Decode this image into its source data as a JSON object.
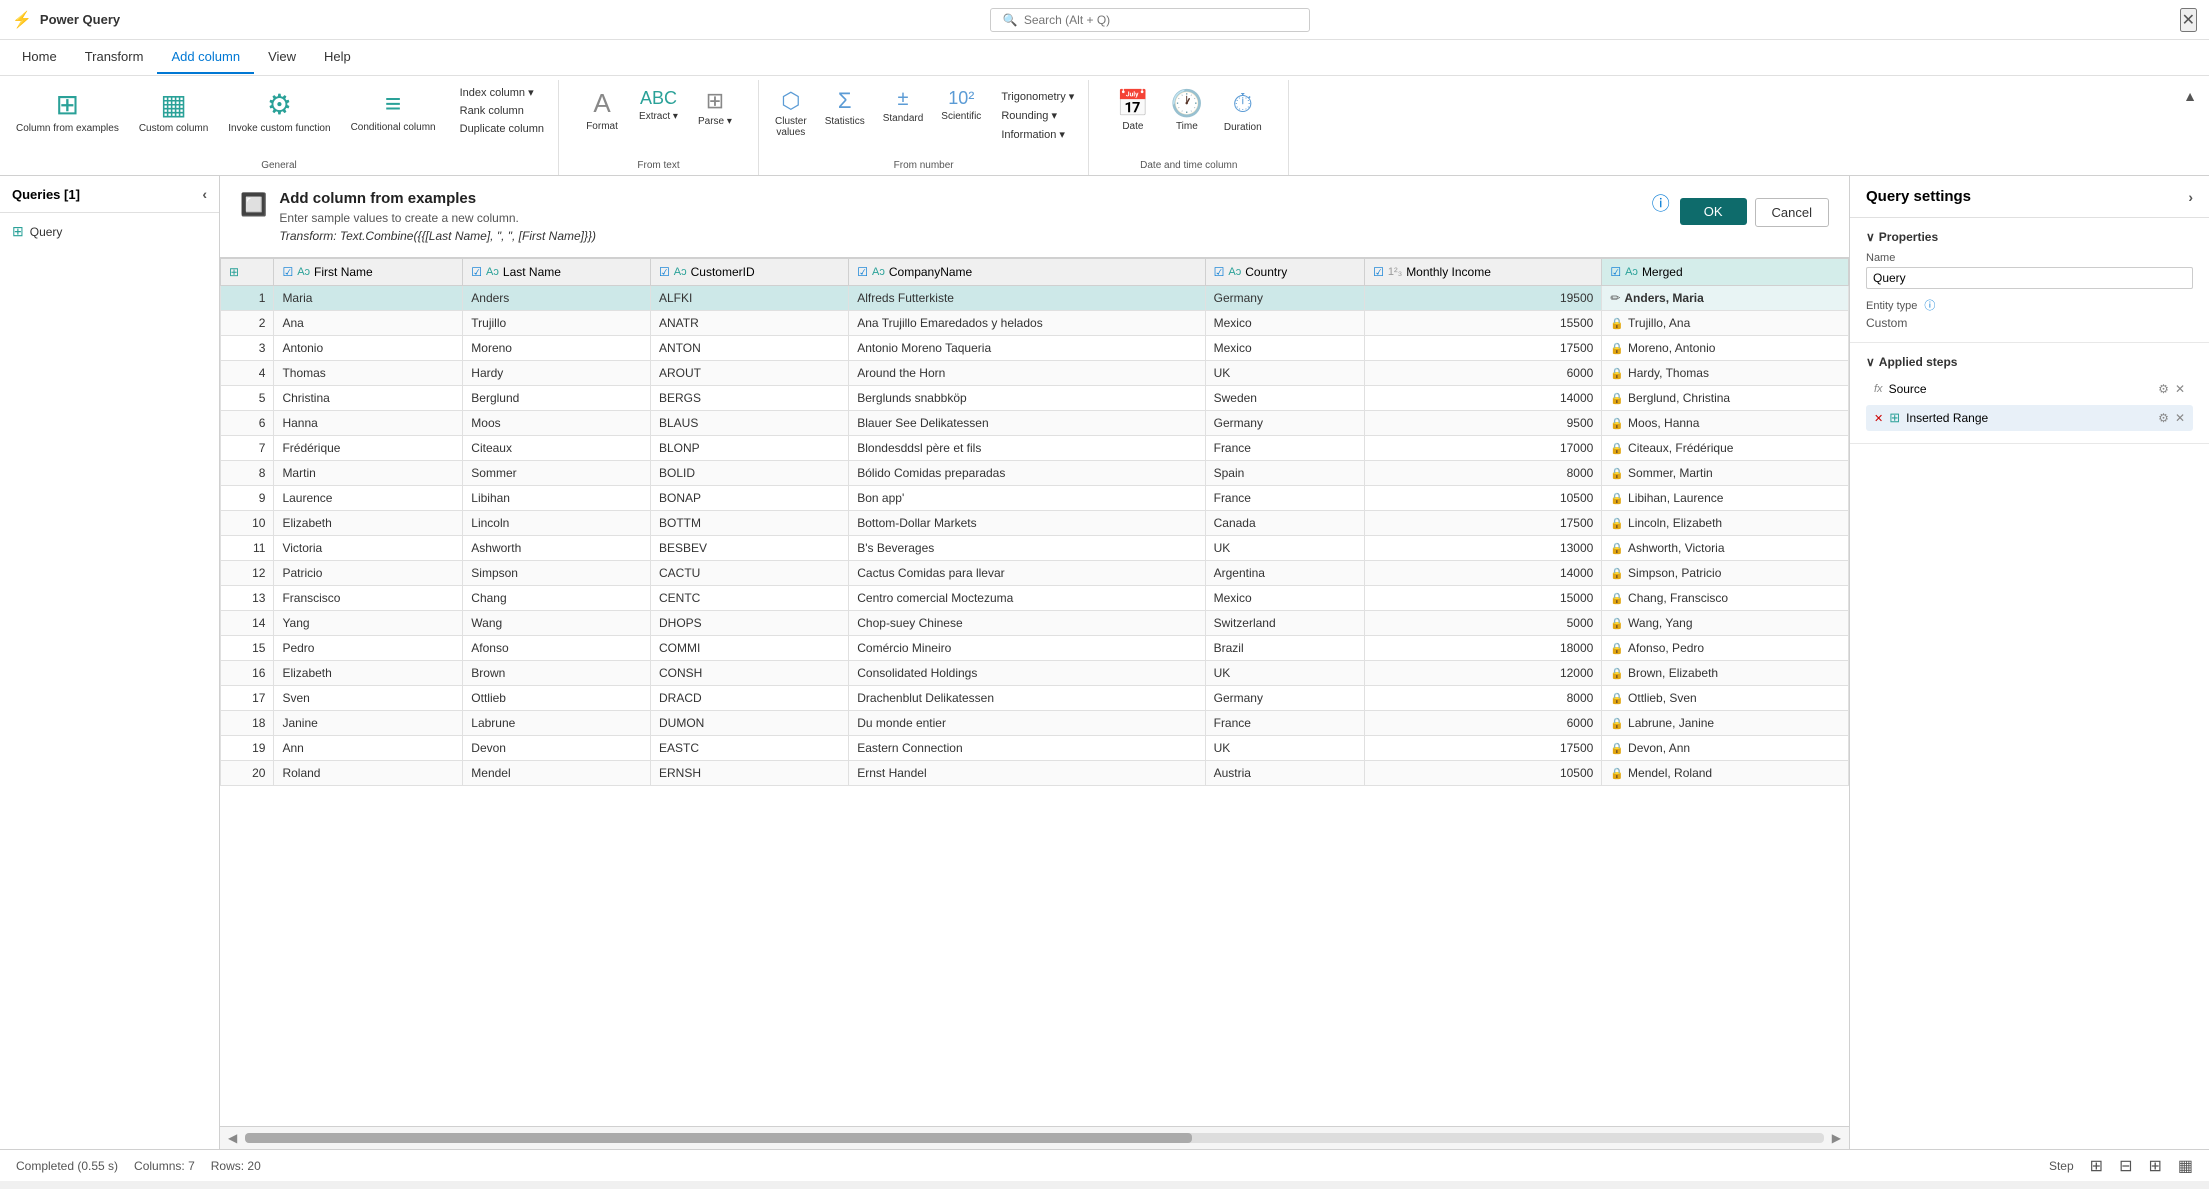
{
  "titleBar": {
    "appName": "Power Query",
    "search": {
      "placeholder": "Search (Alt + Q)"
    },
    "close": "✕"
  },
  "menuBar": {
    "items": [
      {
        "label": "Home",
        "active": false
      },
      {
        "label": "Transform",
        "active": false
      },
      {
        "label": "Add column",
        "active": true
      },
      {
        "label": "View",
        "active": false
      },
      {
        "label": "Help",
        "active": false
      }
    ]
  },
  "ribbon": {
    "groups": [
      {
        "label": "General",
        "buttons": [
          {
            "id": "col-from-examples",
            "icon": "⊞",
            "label": "Column from\nexamples"
          },
          {
            "id": "custom-column",
            "icon": "▦",
            "label": "Custom\ncolumn"
          },
          {
            "id": "invoke-custom",
            "icon": "⚙",
            "label": "Invoke custom\nfunction"
          },
          {
            "id": "conditional-col",
            "icon": "≡",
            "label": "Conditional\ncolumn"
          }
        ],
        "smallButtons": [
          {
            "id": "index-column",
            "label": "Index column ▾"
          },
          {
            "id": "rank-column",
            "label": "Rank column"
          },
          {
            "id": "duplicate-column",
            "label": "Duplicate column"
          }
        ]
      },
      {
        "label": "From text",
        "buttons": [
          {
            "id": "format",
            "icon": "A",
            "label": "Format"
          },
          {
            "id": "extract",
            "icon": "ABC",
            "label": "Extract ▾"
          },
          {
            "id": "parse",
            "icon": "⊞",
            "label": "Parse ▾"
          }
        ]
      },
      {
        "label": "From number",
        "buttons": [
          {
            "id": "cluster-values",
            "icon": "⬡",
            "label": "Cluster\nvalues"
          },
          {
            "id": "statistics",
            "icon": "Σ",
            "label": "Statistics"
          },
          {
            "id": "standard",
            "icon": "±",
            "label": "Standard"
          },
          {
            "id": "scientific",
            "icon": "10²",
            "label": "Scientific"
          },
          {
            "id": "trigonometry",
            "label": "Trigonometry ▾"
          },
          {
            "id": "rounding",
            "label": "Rounding ▾"
          },
          {
            "id": "information",
            "label": "Information ▾"
          }
        ]
      },
      {
        "label": "Date and time column",
        "buttons": [
          {
            "id": "date",
            "icon": "📅",
            "label": "Date"
          },
          {
            "id": "time",
            "icon": "🕐",
            "label": "Time"
          },
          {
            "id": "duration",
            "icon": "⏱",
            "label": "Duration"
          }
        ]
      }
    ],
    "collapseLabel": "▲"
  },
  "queriesPanel": {
    "header": "Queries [1]",
    "items": [
      {
        "label": "Query",
        "icon": "⊞"
      }
    ]
  },
  "examplesBanner": {
    "icon": "🔲",
    "title": "Add column from examples",
    "subtitle": "Enter sample values to create a new column.",
    "transform": "Transform: Text.Combine({{[Last Name], \", \", [First Name]}})",
    "okLabel": "OK",
    "cancelLabel": "Cancel",
    "helpIcon": "ⓘ"
  },
  "table": {
    "columns": [
      {
        "id": "row-num",
        "label": "#"
      },
      {
        "id": "first-name",
        "type": "text",
        "label": "First Name"
      },
      {
        "id": "last-name",
        "type": "text",
        "label": "Last Name"
      },
      {
        "id": "customer-id",
        "type": "text",
        "label": "CustomerID"
      },
      {
        "id": "company-name",
        "type": "text",
        "label": "CompanyName"
      },
      {
        "id": "country",
        "type": "text",
        "label": "Country"
      },
      {
        "id": "monthly-income",
        "type": "num",
        "label": "Monthly Income"
      },
      {
        "id": "merged",
        "type": "text",
        "label": "Merged"
      }
    ],
    "rows": [
      {
        "num": 1,
        "firstName": "Maria",
        "lastName": "Anders",
        "customerId": "ALFKI",
        "companyName": "Alfreds Futterkiste",
        "country": "Germany",
        "monthlyIncome": 19500,
        "merged": "Anders, Maria"
      },
      {
        "num": 2,
        "firstName": "Ana",
        "lastName": "Trujillo",
        "customerId": "ANATR",
        "companyName": "Ana Trujillo Emaredados y helados",
        "country": "Mexico",
        "monthlyIncome": 15500,
        "merged": "Trujillo, Ana"
      },
      {
        "num": 3,
        "firstName": "Antonio",
        "lastName": "Moreno",
        "customerId": "ANTON",
        "companyName": "Antonio Moreno Taqueria",
        "country": "Mexico",
        "monthlyIncome": 17500,
        "merged": "Moreno, Antonio"
      },
      {
        "num": 4,
        "firstName": "Thomas",
        "lastName": "Hardy",
        "customerId": "AROUT",
        "companyName": "Around the Horn",
        "country": "UK",
        "monthlyIncome": 6000,
        "merged": "Hardy, Thomas"
      },
      {
        "num": 5,
        "firstName": "Christina",
        "lastName": "Berglund",
        "customerId": "BERGS",
        "companyName": "Berglunds snabbköp",
        "country": "Sweden",
        "monthlyIncome": 14000,
        "merged": "Berglund, Christina"
      },
      {
        "num": 6,
        "firstName": "Hanna",
        "lastName": "Moos",
        "customerId": "BLAUS",
        "companyName": "Blauer See Delikatessen",
        "country": "Germany",
        "monthlyIncome": 9500,
        "merged": "Moos, Hanna"
      },
      {
        "num": 7,
        "firstName": "Frédérique",
        "lastName": "Citeaux",
        "customerId": "BLONP",
        "companyName": "Blondesddsl père et fils",
        "country": "France",
        "monthlyIncome": 17000,
        "merged": "Citeaux, Frédérique"
      },
      {
        "num": 8,
        "firstName": "Martin",
        "lastName": "Sommer",
        "customerId": "BOLID",
        "companyName": "Bólido Comidas preparadas",
        "country": "Spain",
        "monthlyIncome": 8000,
        "merged": "Sommer, Martin"
      },
      {
        "num": 9,
        "firstName": "Laurence",
        "lastName": "Libihan",
        "customerId": "BONAP",
        "companyName": "Bon app'",
        "country": "France",
        "monthlyIncome": 10500,
        "merged": "Libihan, Laurence"
      },
      {
        "num": 10,
        "firstName": "Elizabeth",
        "lastName": "Lincoln",
        "customerId": "BOTTM",
        "companyName": "Bottom-Dollar Markets",
        "country": "Canada",
        "monthlyIncome": 17500,
        "merged": "Lincoln, Elizabeth"
      },
      {
        "num": 11,
        "firstName": "Victoria",
        "lastName": "Ashworth",
        "customerId": "BESBEV",
        "companyName": "B's Beverages",
        "country": "UK",
        "monthlyIncome": 13000,
        "merged": "Ashworth, Victoria"
      },
      {
        "num": 12,
        "firstName": "Patricio",
        "lastName": "Simpson",
        "customerId": "CACTU",
        "companyName": "Cactus Comidas para llevar",
        "country": "Argentina",
        "monthlyIncome": 14000,
        "merged": "Simpson, Patricio"
      },
      {
        "num": 13,
        "firstName": "Franscisco",
        "lastName": "Chang",
        "customerId": "CENTC",
        "companyName": "Centro comercial Moctezuma",
        "country": "Mexico",
        "monthlyIncome": 15000,
        "merged": "Chang, Franscisco"
      },
      {
        "num": 14,
        "firstName": "Yang",
        "lastName": "Wang",
        "customerId": "DHOPS",
        "companyName": "Chop-suey Chinese",
        "country": "Switzerland",
        "monthlyIncome": 5000,
        "merged": "Wang, Yang"
      },
      {
        "num": 15,
        "firstName": "Pedro",
        "lastName": "Afonso",
        "customerId": "COMMI",
        "companyName": "Comércio Mineiro",
        "country": "Brazil",
        "monthlyIncome": 18000,
        "merged": "Afonso, Pedro"
      },
      {
        "num": 16,
        "firstName": "Elizabeth",
        "lastName": "Brown",
        "customerId": "CONSH",
        "companyName": "Consolidated Holdings",
        "country": "UK",
        "monthlyIncome": 12000,
        "merged": "Brown, Elizabeth"
      },
      {
        "num": 17,
        "firstName": "Sven",
        "lastName": "Ottlieb",
        "customerId": "DRACD",
        "companyName": "Drachenblut Delikatessen",
        "country": "Germany",
        "monthlyIncome": 8000,
        "merged": "Ottlieb, Sven"
      },
      {
        "num": 18,
        "firstName": "Janine",
        "lastName": "Labrune",
        "customerId": "DUMON",
        "companyName": "Du monde entier",
        "country": "France",
        "monthlyIncome": 6000,
        "merged": "Labrune, Janine"
      },
      {
        "num": 19,
        "firstName": "Ann",
        "lastName": "Devon",
        "customerId": "EASTC",
        "companyName": "Eastern Connection",
        "country": "UK",
        "monthlyIncome": 17500,
        "merged": "Devon, Ann"
      },
      {
        "num": 20,
        "firstName": "Roland",
        "lastName": "Mendel",
        "customerId": "ERNSH",
        "companyName": "Ernst Handel",
        "country": "Austria",
        "monthlyIncome": 10500,
        "merged": "Mendel, Roland"
      }
    ]
  },
  "querySettings": {
    "header": "Query settings",
    "chevron": "›",
    "propertiesSection": {
      "title": "Properties",
      "nameLabel": "Name",
      "nameValue": "Query",
      "entityTypeLabel": "Entity type",
      "entityTypeInfo": "ⓘ",
      "entityTypeValue": "Custom"
    },
    "appliedStepsSection": {
      "title": "Applied steps",
      "steps": [
        {
          "id": "source",
          "label": "Source",
          "icon": "fx",
          "type": "fx"
        },
        {
          "id": "inserted-range",
          "label": "Inserted Range",
          "icon": "⊞",
          "type": "table",
          "active": true,
          "hasDelete": true
        }
      ]
    }
  },
  "statusBar": {
    "status": "Completed (0.55 s)",
    "columns": "Columns: 7",
    "rows": "Rows: 20",
    "stepLabel": "Step",
    "icons": [
      "step",
      "grid",
      "table",
      "layout"
    ]
  }
}
